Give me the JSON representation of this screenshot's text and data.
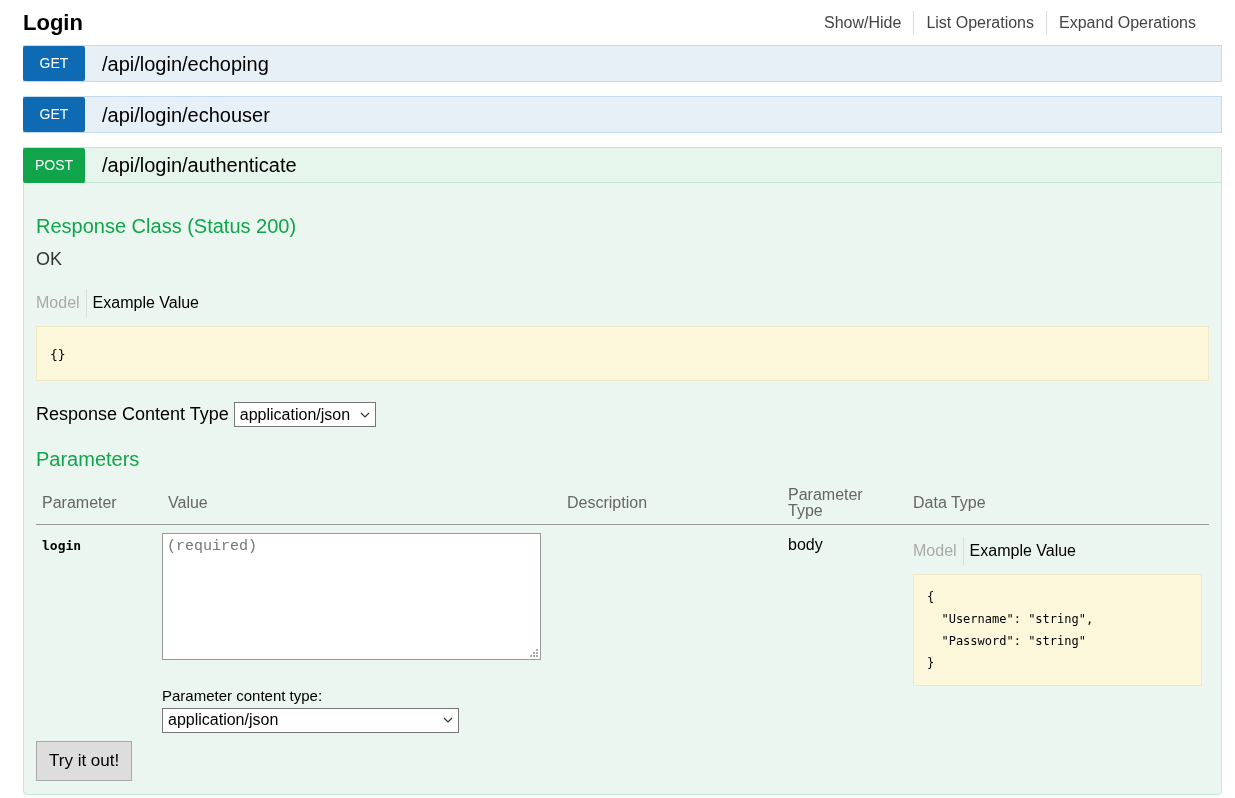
{
  "resource": {
    "title": "Login"
  },
  "header_links": [
    "Show/Hide",
    "List Operations",
    "Expand Operations"
  ],
  "operations": [
    {
      "method": "GET",
      "path": "/api/login/echoping",
      "expanded": false
    },
    {
      "method": "GET",
      "path": "/api/login/echouser",
      "expanded": false
    },
    {
      "method": "POST",
      "path": "/api/login/authenticate",
      "expanded": true
    }
  ],
  "response_class": {
    "heading": "Response Class (Status 200)",
    "description": "OK",
    "tabs": [
      {
        "label": "Model",
        "selected": false
      },
      {
        "label": "Example Value",
        "selected": true
      }
    ],
    "example": "{}"
  },
  "response_content_type": {
    "label": "Response Content Type",
    "value": "application/json"
  },
  "parameters": {
    "heading": "Parameters",
    "columns": [
      "Parameter",
      "Value",
      "Description",
      "Parameter Type",
      "Data Type"
    ],
    "rows": [
      {
        "name": "login",
        "placeholder": "(required)",
        "parameter_type": "body",
        "content_type_label": "Parameter content type:",
        "content_type": "application/json",
        "tabs": [
          {
            "label": "Model",
            "selected": false
          },
          {
            "label": "Example Value",
            "selected": true
          }
        ],
        "example": "{\n  \"Username\": \"string\",\n  \"Password\": \"string\"\n}"
      }
    ]
  },
  "submit_button": "Try it out!"
}
